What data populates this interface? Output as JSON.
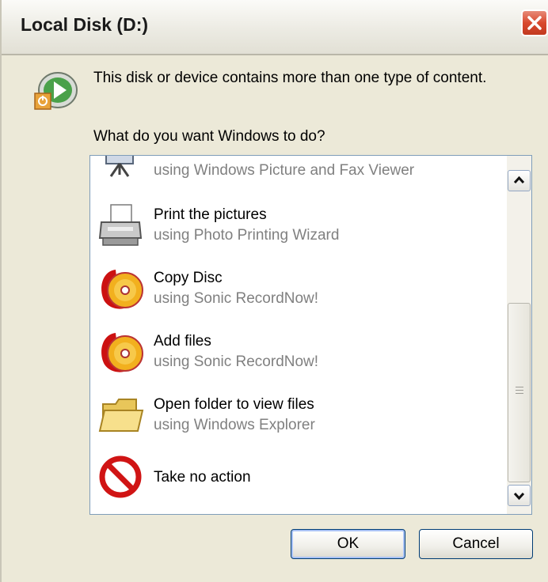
{
  "window": {
    "title": "Local Disk (D:)"
  },
  "header": {
    "message": "This disk or device contains more than one type of content.",
    "prompt": "What do you want Windows to do?"
  },
  "actions": [
    {
      "title": "",
      "subtitle": "using Windows Picture and Fax Viewer",
      "icon": "slideshow-icon"
    },
    {
      "title": "Print the pictures",
      "subtitle": "using Photo Printing Wizard",
      "icon": "printer-icon"
    },
    {
      "title": "Copy Disc",
      "subtitle": "using Sonic RecordNow!",
      "icon": "cd-burn-icon"
    },
    {
      "title": "Add files",
      "subtitle": "using Sonic RecordNow!",
      "icon": "cd-burn-icon"
    },
    {
      "title": "Open folder to view files",
      "subtitle": "using Windows Explorer",
      "icon": "folder-icon"
    },
    {
      "title": "Take no action",
      "subtitle": "",
      "icon": "no-action-icon"
    }
  ],
  "buttons": {
    "ok": "OK",
    "cancel": "Cancel"
  },
  "colors": {
    "subtitle_gray": "#808080",
    "close_red": "#d9492e",
    "dialog_bg": "#ece9d8"
  }
}
